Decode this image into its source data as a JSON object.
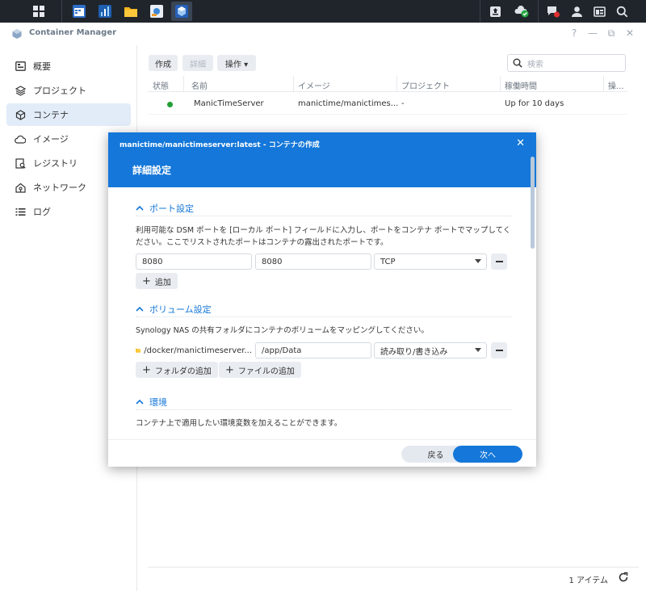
{
  "app": {
    "title": "Container Manager",
    "controls": {
      "help": "?",
      "minimize": "—",
      "maximize": "⧉",
      "close": "✕"
    }
  },
  "sidebar": {
    "items": [
      {
        "label": "概要",
        "icon": "overview-icon"
      },
      {
        "label": "プロジェクト",
        "icon": "project-icon"
      },
      {
        "label": "コンテナ",
        "icon": "container-icon",
        "active": true
      },
      {
        "label": "イメージ",
        "icon": "image-cloud-icon"
      },
      {
        "label": "レジストリ",
        "icon": "registry-icon"
      },
      {
        "label": "ネットワーク",
        "icon": "network-icon"
      },
      {
        "label": "ログ",
        "icon": "log-icon"
      }
    ]
  },
  "toolbar": {
    "create": "作成",
    "detail": "詳細",
    "action": "操作 ▾",
    "search_placeholder": "検索"
  },
  "table": {
    "headers": [
      "状態",
      "名前",
      "イメージ",
      "プロジェクト",
      "稼働時間",
      "操..."
    ],
    "rows": [
      {
        "status": "running",
        "name": "ManicTimeServer",
        "image": "manictime/manictimes...",
        "project": "-",
        "uptime": "Up for 10 days"
      }
    ]
  },
  "footer": {
    "count": "1 アイテム"
  },
  "modal": {
    "title": "manictime/manictimeserver:latest - コンテナの作成",
    "subtitle": "詳細設定",
    "close": "✕",
    "port": {
      "title": "ポート設定",
      "description": "利用可能な DSM ポートを [ローカル ポート] フィールドに入力し、ポートをコンテナ ポートでマップしてください。ここでリストされたポートはコンテナの露出されたポートです。",
      "local_port": "8080",
      "container_port": "8080",
      "protocol": "TCP",
      "add": "追加"
    },
    "volume": {
      "title": "ボリューム設定",
      "description": "Synology NAS の共有フォルダにコンテナのボリュームをマッピングしてください。",
      "folder": "/docker/manictimeserver...",
      "mount": "/app/Data",
      "mode": "読み取り/書き込み",
      "add_folder": "フォルダの追加",
      "add_file": "ファイルの追加"
    },
    "env": {
      "title": "環境",
      "description": "コンテナ上で適用したい環境変数を加えることができます。"
    },
    "back": "戻る",
    "next": "次へ"
  },
  "colors": {
    "accent": "#1477d9",
    "taskbar": "#20252c",
    "running": "#23a035"
  }
}
